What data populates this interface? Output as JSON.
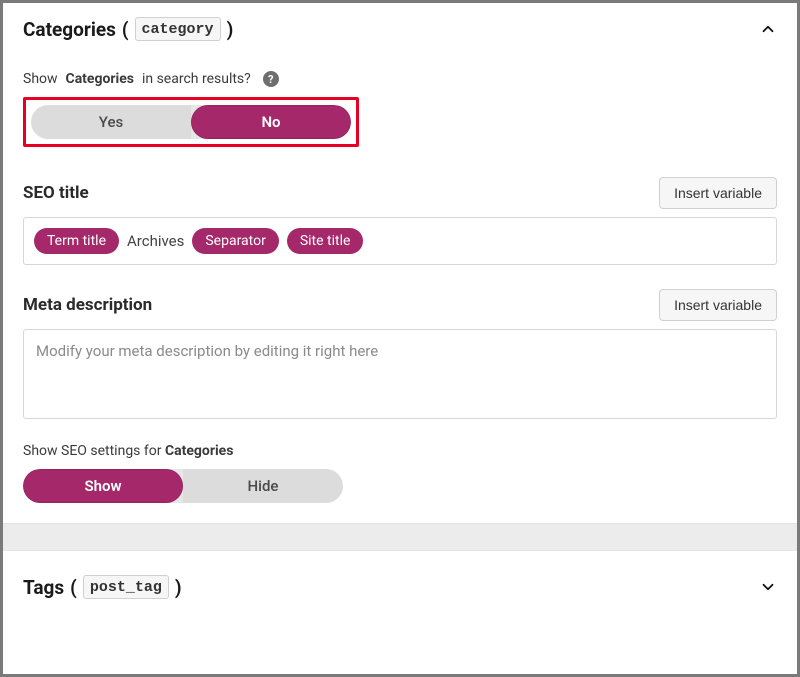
{
  "panels": {
    "categories": {
      "title_prefix": "Categories",
      "slug": "category",
      "expanded": true
    },
    "tags": {
      "title_prefix": "Tags",
      "slug": "post_tag",
      "expanded": false
    }
  },
  "search_results_question": {
    "pre": "Show",
    "bold": "Categories",
    "post": "in search results?",
    "help": "?",
    "options": {
      "yes": "Yes",
      "no": "No"
    },
    "selected": "no"
  },
  "seo_title": {
    "label": "SEO title",
    "insert_variable": "Insert variable",
    "tokens": [
      {
        "type": "pill",
        "text": "Term title"
      },
      {
        "type": "plain",
        "text": "Archives"
      },
      {
        "type": "pill",
        "text": "Separator"
      },
      {
        "type": "pill",
        "text": "Site title"
      }
    ]
  },
  "meta_description": {
    "label": "Meta description",
    "insert_variable": "Insert variable",
    "placeholder": "Modify your meta description by editing it right here"
  },
  "seo_settings_toggle": {
    "pre": "Show SEO settings for",
    "bold": "Categories",
    "options": {
      "show": "Show",
      "hide": "Hide"
    },
    "selected": "show"
  }
}
